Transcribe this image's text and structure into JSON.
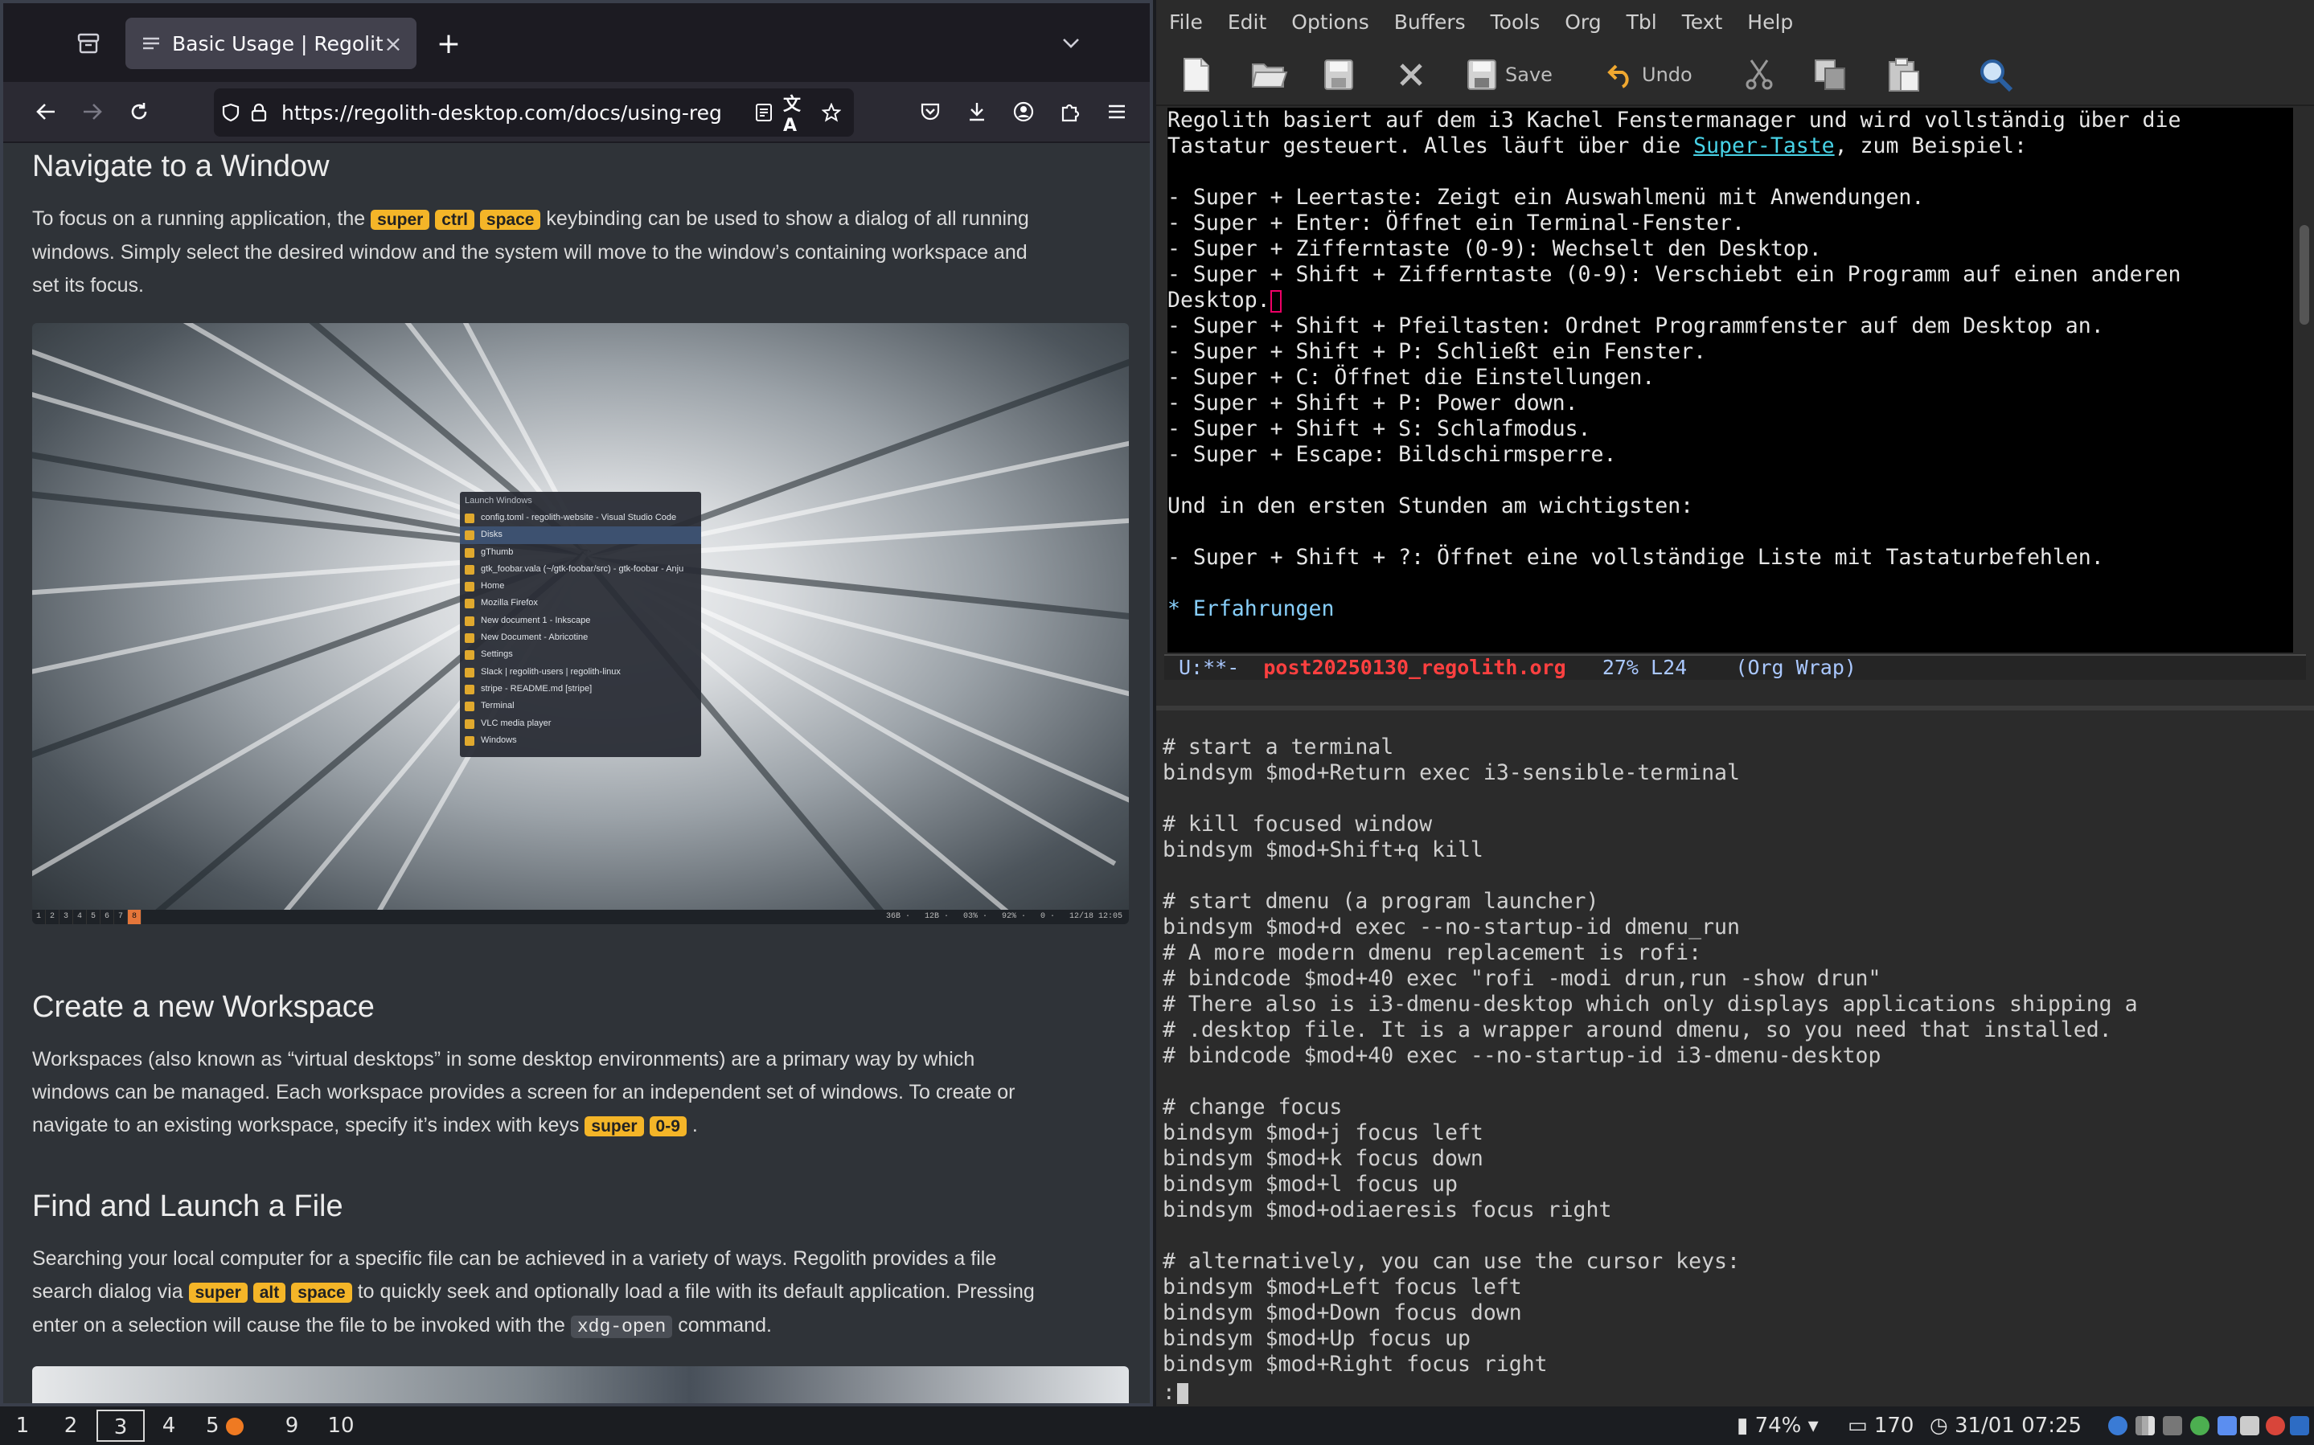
{
  "browser": {
    "tab_title": "Basic Usage | Regolith",
    "url": "https://regolith-desktop.com/docs/using-reg",
    "sections": {
      "nav_window": {
        "title": "Navigate to a Window",
        "p_pre": "To focus on a running application, the",
        "keys": [
          "super",
          "ctrl",
          "space"
        ],
        "p_mid": "keybinding can be used to show a dialog of all running",
        "p_line2": "windows. Simply select the desired window and the system will move to the window’s containing workspace and",
        "p_line3": "set its focus."
      },
      "workspace": {
        "title": "Create a new Workspace",
        "line1": "Workspaces (also known as “virtual desktops” in some desktop environments) are a primary way by which",
        "line2": "windows can be managed. Each workspace provides a screen for an independent set of windows. To create or",
        "line3_pre": "navigate to an existing workspace, specify it’s index with keys",
        "keys": [
          "super",
          "0-9"
        ],
        "line3_post": "."
      },
      "find_file": {
        "title": "Find and Launch a File",
        "line1": "Searching your local computer for a specific file can be achieved in a variety of ways. Regolith provides a file",
        "line2_pre": "search dialog via",
        "keys": [
          "super",
          "alt",
          "space"
        ],
        "line2_post": "to quickly seek and optionally load a file with its default application. Pressing",
        "line3_pre": "enter on a selection will cause the file to be invoked with the",
        "code": "xdg-open",
        "line3_post": "command."
      }
    },
    "launcher": {
      "header": "Launch Windows",
      "items": [
        "config.toml - regolith-website - Visual Studio Code",
        "Disks",
        "gThumb",
        "gtk_foobar.vala (~/gtk-foobar/src) - gtk-foobar - Anju",
        "Home",
        "Mozilla Firefox",
        "New document 1 - Inkscape",
        "New Document - Abricotine",
        "Settings",
        "Slack | regolith-users | regolith-linux",
        "stripe - README.md [stripe]",
        "Terminal",
        "VLC media player",
        "Windows"
      ],
      "selected_index": 1
    },
    "mini_bar": {
      "workspaces": [
        "1",
        "2",
        "3",
        "4",
        "5",
        "6",
        "7",
        "8"
      ],
      "active": "8",
      "status": "36B ·   12B ·   03% ·   92% ·   0 ·   12/18 12:05"
    }
  },
  "emacs": {
    "menu": [
      "File",
      "Edit",
      "Options",
      "Buffers",
      "Tools",
      "Org",
      "Tbl",
      "Text",
      "Help"
    ],
    "toolbar": {
      "save": "Save",
      "undo": "Undo"
    },
    "org": {
      "line1": "Regolith basiert auf dem i3 Kachel Fenstermanager und wird vollständig über die",
      "line2_pre": "Tastatur gesteuert. Alles läuft über die ",
      "line2_link": "Super-Taste",
      "line2_post": ", zum Beispiel:",
      "bullets_a": [
        "- Super + Leertaste: Zeigt ein Auswahlmenü mit Anwendungen.",
        "- Super + Enter: Öffnet ein Terminal-Fenster.",
        "- Super + Zifferntaste (0-9): Wechselt den Desktop.",
        "- Super + Shift + Zifferntaste (0-9): Verschiebt ein Programm auf einen anderen"
      ],
      "wrap": "Desktop.",
      "bullets_b": [
        "- Super + Shift + Pfeiltasten: Ordnet Programmfenster auf dem Desktop an.",
        "- Super + Shift + P: Schließt ein Fenster.",
        "- Super + C: Öffnet die Einstellungen.",
        "- Super + Shift + P: Power down.",
        "- Super + Shift + S: Schlafmodus.",
        "- Super + Escape: Bildschirmsperre."
      ],
      "para": "Und in den ersten Stunden am wichtigsten:",
      "bullet_c": "- Super + Shift + ?: Öffnet eine vollständige Liste mit Tastaturbefehlen.",
      "heading": "* Erfahrungen"
    },
    "modeline": {
      "state": "U:**-",
      "buffer": "post20250130_regolith.org",
      "position": "27% L24",
      "mode": "(Org Wrap)"
    },
    "term_lines": [
      "# start a terminal",
      "bindsym $mod+Return exec i3-sensible-terminal",
      "",
      "# kill focused window",
      "bindsym $mod+Shift+q kill",
      "",
      "# start dmenu (a program launcher)",
      "bindsym $mod+d exec --no-startup-id dmenu_run",
      "# A more modern dmenu replacement is rofi:",
      "# bindcode $mod+40 exec \"rofi -modi drun,run -show drun\"",
      "# There also is i3-dmenu-desktop which only displays applications shipping a",
      "# .desktop file. It is a wrapper around dmenu, so you need that installed.",
      "# bindcode $mod+40 exec --no-startup-id i3-dmenu-desktop",
      "",
      "# change focus",
      "bindsym $mod+j focus left",
      "bindsym $mod+k focus down",
      "bindsym $mod+l focus up",
      "bindsym $mod+odiaeresis focus right",
      "",
      "# alternatively, you can use the cursor keys:",
      "bindsym $mod+Left focus left",
      "bindsym $mod+Down focus down",
      "bindsym $mod+Up focus up",
      "bindsym $mod+Right focus right"
    ],
    "minibuffer": ":"
  },
  "statusbar": {
    "workspaces": [
      "1",
      "2",
      "3",
      "4",
      "5",
      "9",
      "10"
    ],
    "active_workspace": "3",
    "notify_workspace": "5",
    "battery": "74%",
    "notifications": "170",
    "datetime": "31/01 07:25"
  },
  "colors": {
    "kbd": "#f4b528",
    "accent_orange": "#ef7a22",
    "link": "#48d2e6",
    "buffer_name": "#ff4040"
  }
}
